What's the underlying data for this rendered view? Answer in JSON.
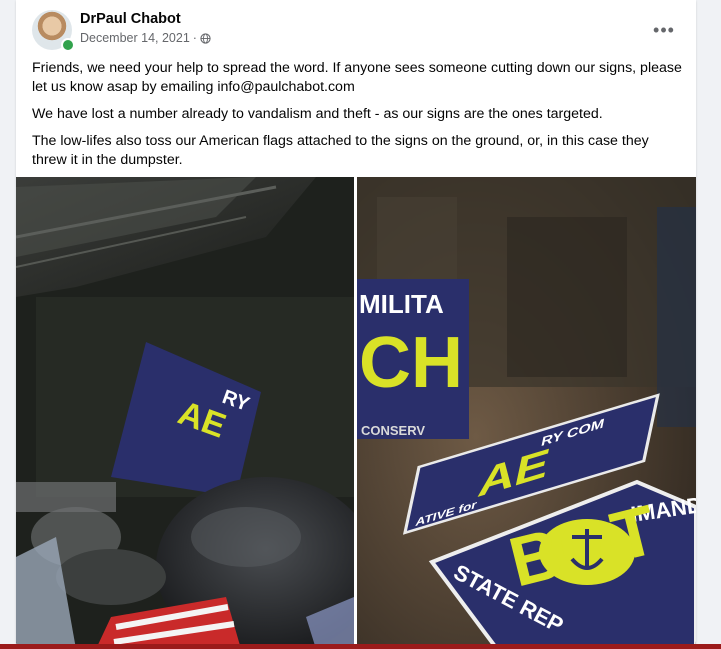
{
  "post": {
    "author": "DrPaul Chabot",
    "date": "December 14, 2021",
    "separator": "·",
    "paragraphs": [
      "Friends, we need your help to spread the word. If anyone sees someone cutting down our signs, please let us know asap by emailing info@paulchabot.com",
      "We have lost a number already to vandalism and theft - as our signs are the ones targeted.",
      "The low-lifes also toss our American flags attached to the signs on the ground, or, in this case they threw it in the dumpster."
    ],
    "more_label": "•••"
  },
  "photo_left": {
    "sign_lines": [
      "RY",
      "AE"
    ]
  },
  "photo_right": {
    "sign1_top": "MILITA",
    "sign1_big": "CH",
    "sign1_bottom": "CONSERV",
    "sign2_top": "RY COM",
    "sign2_big": "AE",
    "sign2_bottom": "ATIVE for",
    "sign3_top": "IMANDE",
    "sign3_big": "BOT",
    "sign3_bottom": "STATE REP"
  },
  "colors": {
    "sign_navy": "#2a2f6b",
    "sign_yellow": "#d9e227",
    "online": "#31a24c"
  }
}
